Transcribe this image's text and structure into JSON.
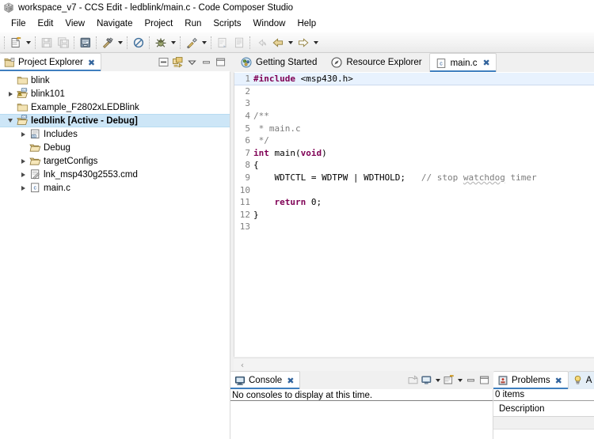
{
  "window": {
    "title": "workspace_v7 - CCS Edit - ledblink/main.c - Code Composer Studio",
    "app_icon": "ccs-cube-icon"
  },
  "menubar": {
    "items": [
      {
        "label": "File"
      },
      {
        "label": "Edit"
      },
      {
        "label": "View"
      },
      {
        "label": "Navigate"
      },
      {
        "label": "Project"
      },
      {
        "label": "Run"
      },
      {
        "label": "Scripts"
      },
      {
        "label": "Window"
      },
      {
        "label": "Help"
      }
    ]
  },
  "toolbar": {
    "groups": [
      {
        "buttons": [
          {
            "icon": "new-file-icon",
            "dropdown": true,
            "enabled": true
          }
        ]
      },
      {
        "buttons": [
          {
            "icon": "save-icon",
            "dropdown": false,
            "enabled": false
          },
          {
            "icon": "save-all-icon",
            "dropdown": false,
            "enabled": false
          }
        ]
      },
      {
        "buttons": [
          {
            "icon": "print-icon",
            "dropdown": false,
            "enabled": true
          }
        ]
      },
      {
        "buttons": [
          {
            "icon": "build-hammer-icon",
            "dropdown": true,
            "enabled": true
          }
        ]
      },
      {
        "buttons": [
          {
            "icon": "no-build-icon",
            "dropdown": false,
            "enabled": true
          }
        ]
      },
      {
        "buttons": [
          {
            "icon": "debug-bug-icon",
            "dropdown": true,
            "enabled": true
          }
        ]
      },
      {
        "buttons": [
          {
            "icon": "run-external-tools-icon",
            "dropdown": true,
            "enabled": true
          }
        ]
      },
      {
        "buttons": [
          {
            "icon": "next-annotation-icon",
            "dropdown": false,
            "enabled": false
          },
          {
            "icon": "previous-annotation-icon",
            "dropdown": false,
            "enabled": false
          }
        ]
      },
      {
        "buttons": [
          {
            "icon": "last-edit-location-icon",
            "dropdown": false,
            "enabled": false
          },
          {
            "icon": "back-arrow-icon",
            "dropdown": true,
            "enabled": true
          },
          {
            "icon": "forward-arrow-icon",
            "dropdown": true,
            "enabled": true
          }
        ]
      }
    ]
  },
  "project_explorer": {
    "tab_label": "Project Explorer",
    "tab_icon": "project-explorer-icon",
    "close_label": "✖",
    "tools": [
      {
        "icon": "collapse-all-icon",
        "name": "collapse-all-button"
      },
      {
        "icon": "link-with-editor-icon",
        "name": "link-with-editor-button"
      },
      {
        "icon": "view-menu-icon",
        "name": "view-menu-button"
      },
      {
        "icon": "minimize-icon",
        "name": "minimize-button"
      },
      {
        "icon": "maximize-icon",
        "name": "maximize-button"
      }
    ],
    "tree": [
      {
        "label": "blink",
        "icon": "folder-closed-icon",
        "twist": "none",
        "indent": 1,
        "bold": false,
        "selected": false
      },
      {
        "label": "blink101",
        "icon": "ccs-project-warning-icon",
        "twist": "collapsed",
        "indent": 1,
        "bold": false,
        "selected": false
      },
      {
        "label": "Example_F2802xLEDBlink",
        "icon": "folder-closed-icon",
        "twist": "none",
        "indent": 1,
        "bold": false,
        "selected": false
      },
      {
        "label": "ledblink  [Active - Debug]",
        "icon": "ccs-project-open-icon",
        "twist": "expanded",
        "indent": 1,
        "bold": true,
        "selected": true
      },
      {
        "label": "Includes",
        "icon": "includes-icon",
        "twist": "collapsed",
        "indent": 2,
        "bold": false,
        "selected": false
      },
      {
        "label": "Debug",
        "icon": "folder-open-icon",
        "twist": "none",
        "indent": 2,
        "bold": false,
        "selected": false
      },
      {
        "label": "targetConfigs",
        "icon": "folder-open-icon",
        "twist": "collapsed",
        "indent": 2,
        "bold": false,
        "selected": false
      },
      {
        "label": "lnk_msp430g2553.cmd",
        "icon": "cmd-file-icon",
        "twist": "collapsed",
        "indent": 2,
        "bold": false,
        "selected": false
      },
      {
        "label": "main.c",
        "icon": "c-file-icon",
        "twist": "collapsed",
        "indent": 2,
        "bold": false,
        "selected": false
      }
    ]
  },
  "editor": {
    "tabs": [
      {
        "label": "Getting Started",
        "icon": "getting-started-icon",
        "active": false,
        "closable": false
      },
      {
        "label": "Resource Explorer",
        "icon": "resource-explorer-icon",
        "active": false,
        "closable": false
      },
      {
        "label": "main.c",
        "icon": "c-file-icon",
        "active": true,
        "closable": true,
        "close_label": "✖"
      }
    ],
    "scroll_chevron": "‹",
    "lines": [
      {
        "n": "1",
        "current": true,
        "tokens": [
          {
            "t": "#include ",
            "c": "pp"
          },
          {
            "t": "<msp430.h>",
            "c": "plain"
          }
        ]
      },
      {
        "n": "2",
        "current": false,
        "tokens": []
      },
      {
        "n": "3",
        "current": false,
        "tokens": []
      },
      {
        "n": "4",
        "current": false,
        "tokens": [
          {
            "t": "/**",
            "c": "cmt"
          }
        ]
      },
      {
        "n": "5",
        "current": false,
        "tokens": [
          {
            "t": " * main.c",
            "c": "cmt"
          }
        ]
      },
      {
        "n": "6",
        "current": false,
        "tokens": [
          {
            "t": " */",
            "c": "cmt"
          }
        ]
      },
      {
        "n": "7",
        "current": false,
        "tokens": [
          {
            "t": "int",
            "c": "kw"
          },
          {
            "t": " main(",
            "c": "plain"
          },
          {
            "t": "void",
            "c": "kw"
          },
          {
            "t": ")",
            "c": "plain"
          }
        ]
      },
      {
        "n": "8",
        "current": false,
        "tokens": [
          {
            "t": "{",
            "c": "plain"
          }
        ]
      },
      {
        "n": "9",
        "current": false,
        "tokens": [
          {
            "t": "    WDTCTL = WDTPW | WDTHOLD;   ",
            "c": "plain"
          },
          {
            "t": "// stop ",
            "c": "cmt"
          },
          {
            "t": "watchdog",
            "c": "cmt-wavy"
          },
          {
            "t": " timer",
            "c": "cmt"
          }
        ]
      },
      {
        "n": "10",
        "current": false,
        "tokens": []
      },
      {
        "n": "11",
        "current": false,
        "tokens": [
          {
            "t": "    ",
            "c": "plain"
          },
          {
            "t": "return",
            "c": "kw"
          },
          {
            "t": " 0;",
            "c": "plain"
          }
        ]
      },
      {
        "n": "12",
        "current": false,
        "tokens": [
          {
            "t": "}",
            "c": "plain"
          }
        ]
      },
      {
        "n": "13",
        "current": false,
        "tokens": []
      }
    ]
  },
  "console": {
    "tab_label": "Console",
    "tab_icon": "console-icon",
    "close_label": "✖",
    "message": "No consoles to display at this time.",
    "tools": [
      {
        "icon": "open-console-icon",
        "name": "open-console-button"
      },
      {
        "icon": "display-selected-console-icon",
        "name": "display-selected-console-button",
        "dropdown": true
      },
      {
        "icon": "new-console-view-icon",
        "name": "new-console-view-button",
        "dropdown": true
      },
      {
        "icon": "minimize-icon",
        "name": "console-minimize-button"
      },
      {
        "icon": "maximize-icon",
        "name": "console-maximize-button"
      }
    ]
  },
  "problems": {
    "tab_label": "Problems",
    "tab_icon": "problems-icon",
    "close_label": "✖",
    "count_text": "0 items",
    "column_header": "Description",
    "next_tab_label": "A",
    "next_tab_icon": "advice-bulb-icon"
  },
  "colors": {
    "accent_tab_underline": "#3f7fbf",
    "selection": "#cde6f7",
    "current_line": "#e8f2fe",
    "keyword": "#7f0055",
    "comment": "#7c7c7c",
    "chrome": "#f0f0f0"
  }
}
